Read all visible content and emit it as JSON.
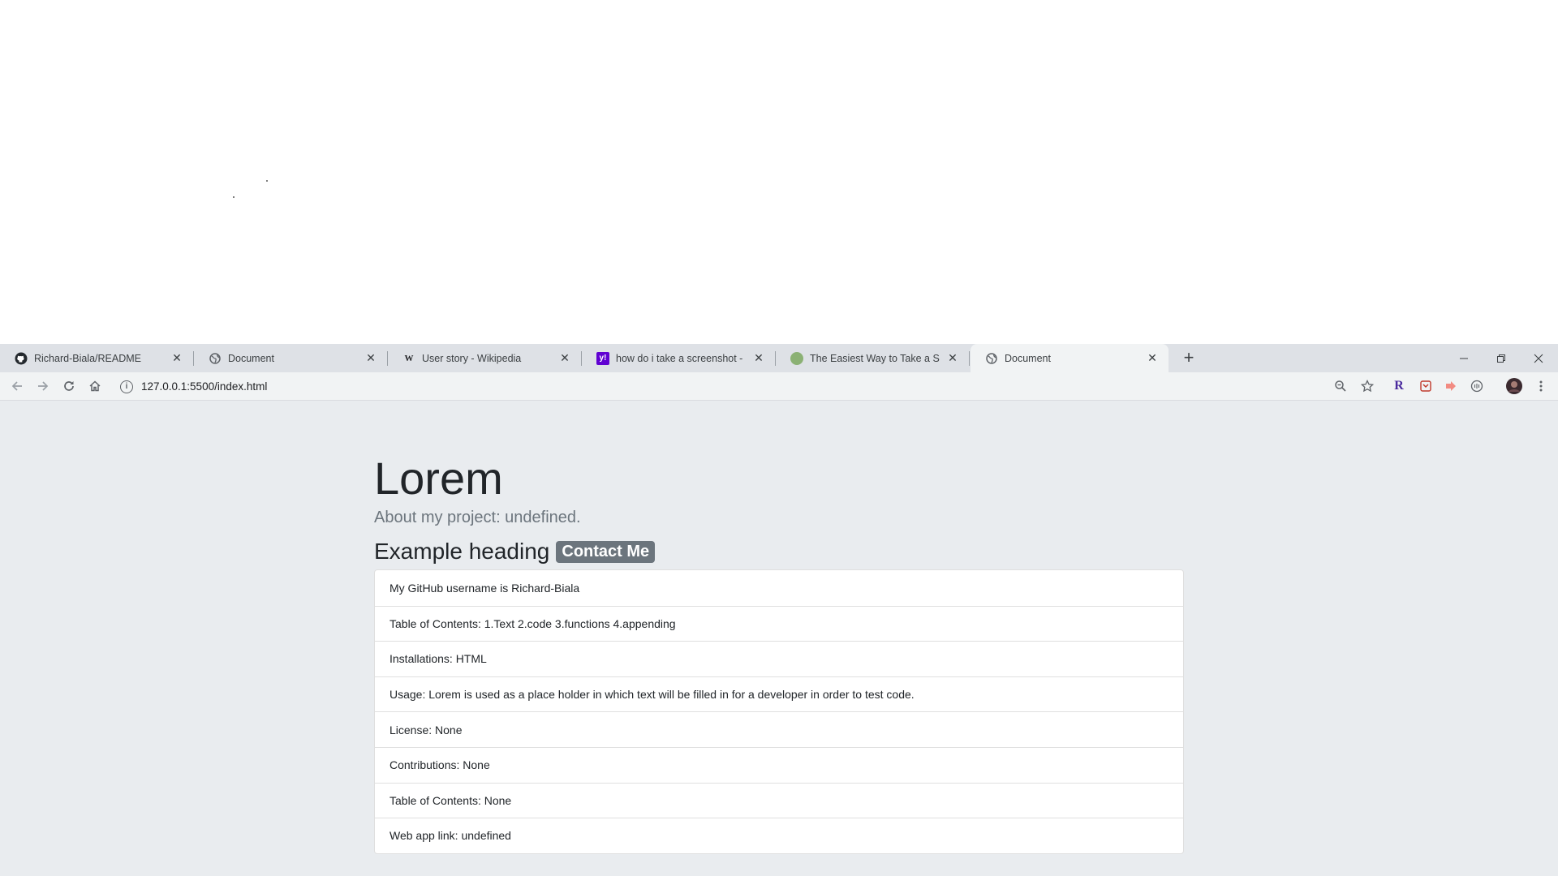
{
  "browser": {
    "tabs": [
      {
        "title": "Richard-Biala/README",
        "icon": "github-icon",
        "active": false
      },
      {
        "title": "Document",
        "icon": "globe-icon",
        "active": false
      },
      {
        "title": "User story - Wikipedia",
        "icon": "wikipedia-icon",
        "active": false
      },
      {
        "title": "how do i take a screenshot - Yah",
        "icon": "yahoo-icon",
        "active": false
      },
      {
        "title": "The Easiest Way to Take a Screen",
        "icon": "site-icon",
        "active": false
      },
      {
        "title": "Document",
        "icon": "globe-icon",
        "active": true
      }
    ],
    "close_glyph": "✕",
    "new_tab_glyph": "+",
    "url": "127.0.0.1:5500/index.html",
    "extensions": [
      "zoom-icon",
      "bookmark-star-icon",
      "r-extension-icon",
      "pocket-icon",
      "share-extension-icon",
      "reader-icon",
      "profile-avatar",
      "menu-icon"
    ]
  },
  "page": {
    "title": "Lorem",
    "subtitle": "About my project: undefined.",
    "heading": "Example heading",
    "badge": "Contact Me",
    "items": [
      "My GitHub username is Richard-Biala",
      "Table of Contents: 1.Text 2.code 3.functions 4.appending",
      "Installations: HTML",
      "Usage: Lorem is used as a place holder in which text will be filled in for a developer in order to test code.",
      "License: None",
      "Contributions: None",
      "Table of Contents: None",
      "Web app link: undefined"
    ]
  },
  "colors": {
    "jumbotron_bg": "#e9ecef",
    "badge_bg": "#6c757d",
    "tabstrip_bg": "#dee1e6",
    "toolbar_bg": "#f1f3f4"
  }
}
